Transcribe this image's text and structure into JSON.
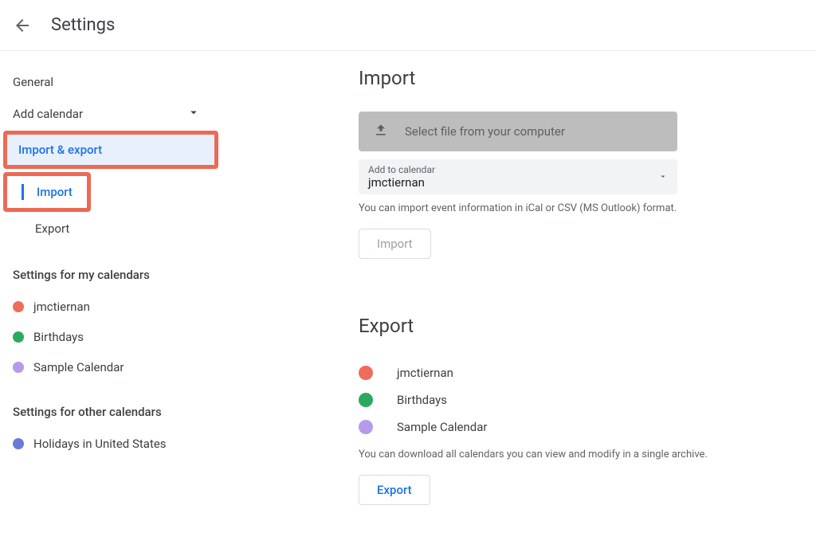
{
  "header": {
    "title": "Settings"
  },
  "sidebar": {
    "general": "General",
    "add_calendar": "Add calendar",
    "import_export": "Import & export",
    "sub_import": "Import",
    "sub_export": "Export",
    "settings_my": "Settings for my calendars",
    "my_calendars": [
      {
        "label": "jmctiernan",
        "color": "#ef6c5b"
      },
      {
        "label": "Birthdays",
        "color": "#2baa5f"
      },
      {
        "label": "Sample Calendar",
        "color": "#b49beb"
      }
    ],
    "settings_other": "Settings for other calendars",
    "other_calendars": [
      {
        "label": "Holidays in United States",
        "color": "#6a7bd6"
      }
    ]
  },
  "import": {
    "title": "Import",
    "select_file": "Select file from your computer",
    "add_to_calendar_label": "Add to calendar",
    "add_to_calendar_value": "jmctiernan",
    "helper": "You can import event information in iCal or CSV (MS Outlook) format.",
    "button": "Import"
  },
  "export": {
    "title": "Export",
    "calendars": [
      {
        "label": "jmctiernan",
        "color": "#ef6c5b"
      },
      {
        "label": "Birthdays",
        "color": "#2baa5f"
      },
      {
        "label": "Sample Calendar",
        "color": "#b49beb"
      }
    ],
    "helper": "You can download all calendars you can view and modify in a single archive.",
    "button": "Export"
  }
}
